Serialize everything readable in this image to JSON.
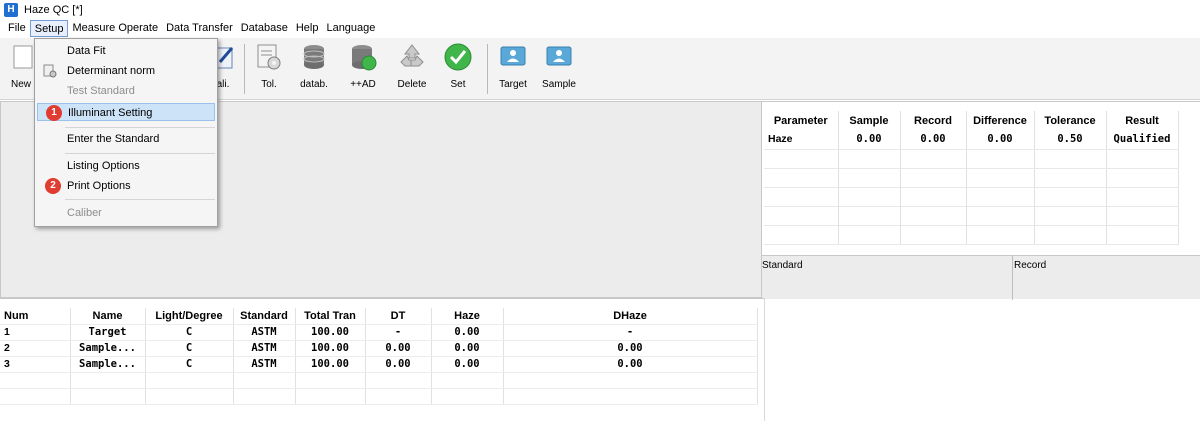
{
  "window": {
    "title": "Haze QC [*]",
    "icon_letter": "H"
  },
  "menu": {
    "items": [
      "File",
      "Setup",
      "Measure Operate",
      "Data Transfer",
      "Database",
      "Help",
      "Language"
    ],
    "active": "Setup"
  },
  "toolbar": {
    "buttons": [
      {
        "label": "New",
        "icon": "new-document-icon"
      },
      {
        "label": "ali.",
        "icon": "calibrate-icon"
      },
      {
        "label": "Tol.",
        "icon": "tolerance-settings-icon"
      },
      {
        "label": "datab.",
        "icon": "database-icon"
      },
      {
        "label": "++AD",
        "icon": "database-add-icon"
      },
      {
        "label": "Delete",
        "icon": "recycle-icon"
      },
      {
        "label": "Set",
        "icon": "check-icon"
      },
      {
        "label": "Target",
        "icon": "target-person-icon"
      },
      {
        "label": "Sample",
        "icon": "sample-person-icon"
      }
    ]
  },
  "setup_menu": {
    "items": [
      {
        "label": "Data Fit",
        "enabled": true
      },
      {
        "label": "Determinant norm",
        "enabled": true
      },
      {
        "label": "Test Standard",
        "enabled": false
      },
      {
        "label": "Illuminant Setting",
        "enabled": true,
        "badge": "1"
      },
      {
        "label": "Enter the Standard",
        "enabled": true
      },
      {
        "label": "Listing Options",
        "enabled": true
      },
      {
        "label": "Print Options",
        "enabled": true,
        "badge": "2"
      },
      {
        "label": "Caliber",
        "enabled": false
      }
    ]
  },
  "result_table": {
    "headers": [
      "Parameter",
      "Sample",
      "Record",
      "Difference",
      "Tolerance",
      "Result"
    ],
    "rows": [
      [
        "Haze",
        "0.00",
        "0.00",
        "0.00",
        "0.50",
        "Qualified"
      ]
    ]
  },
  "standard_area": {
    "standard_label": "Standard",
    "record_label": "Record"
  },
  "list_table": {
    "headers": [
      "Num",
      "Name",
      "Light/Degree",
      "Standard",
      "Total Tran",
      "DT",
      "Haze",
      "DHaze"
    ],
    "rows": [
      [
        "1",
        "Target",
        "C",
        "ASTM",
        "100.00",
        "-",
        "0.00",
        "-"
      ],
      [
        "2",
        "Sample...",
        "C",
        "ASTM",
        "100.00",
        "0.00",
        "0.00",
        "0.00"
      ],
      [
        "3",
        "Sample...",
        "C",
        "ASTM",
        "100.00",
        "0.00",
        "0.00",
        "0.00"
      ]
    ]
  },
  "colors": {
    "accent": "#1f6fd1",
    "badge": "#e03c31",
    "highlight": "#cde3f8",
    "check_green": "#3fb54a"
  }
}
